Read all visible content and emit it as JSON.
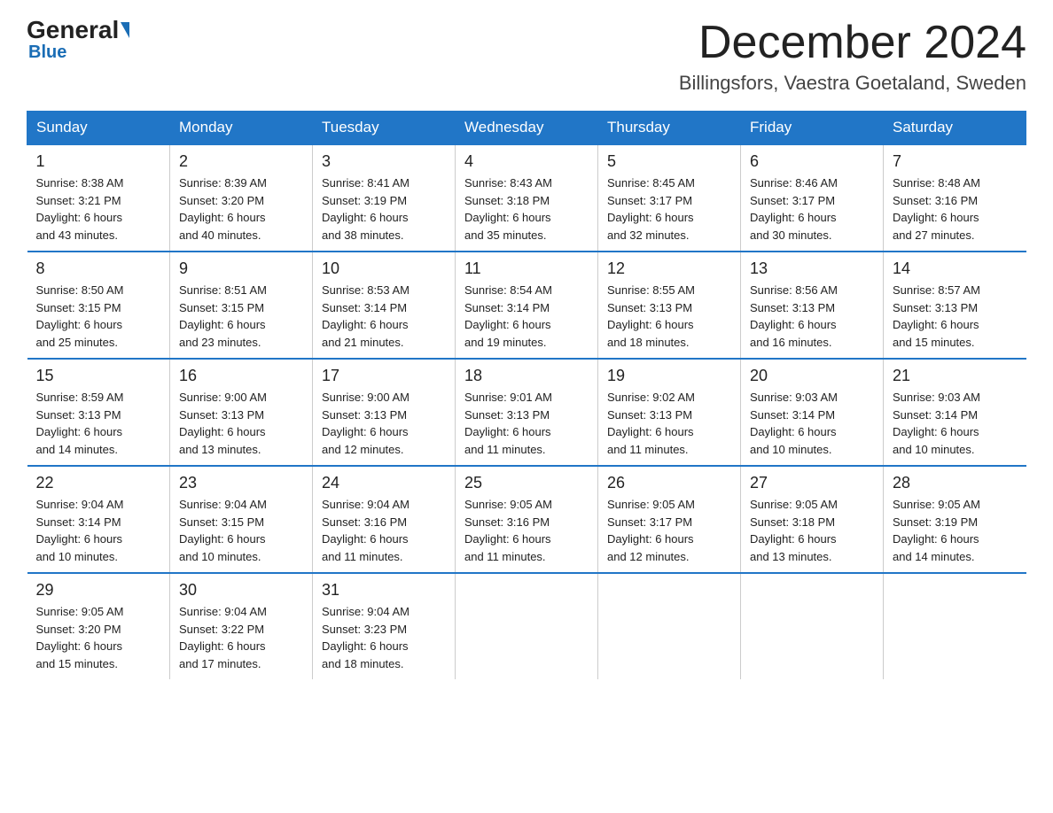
{
  "header": {
    "logo_general": "General",
    "logo_blue": "Blue",
    "month_title": "December 2024",
    "location": "Billingsfors, Vaestra Goetaland, Sweden"
  },
  "days_of_week": [
    "Sunday",
    "Monday",
    "Tuesday",
    "Wednesday",
    "Thursday",
    "Friday",
    "Saturday"
  ],
  "weeks": [
    [
      {
        "day": "1",
        "sunrise": "8:38 AM",
        "sunset": "3:21 PM",
        "daylight": "6 hours and 43 minutes."
      },
      {
        "day": "2",
        "sunrise": "8:39 AM",
        "sunset": "3:20 PM",
        "daylight": "6 hours and 40 minutes."
      },
      {
        "day": "3",
        "sunrise": "8:41 AM",
        "sunset": "3:19 PM",
        "daylight": "6 hours and 38 minutes."
      },
      {
        "day": "4",
        "sunrise": "8:43 AM",
        "sunset": "3:18 PM",
        "daylight": "6 hours and 35 minutes."
      },
      {
        "day": "5",
        "sunrise": "8:45 AM",
        "sunset": "3:17 PM",
        "daylight": "6 hours and 32 minutes."
      },
      {
        "day": "6",
        "sunrise": "8:46 AM",
        "sunset": "3:17 PM",
        "daylight": "6 hours and 30 minutes."
      },
      {
        "day": "7",
        "sunrise": "8:48 AM",
        "sunset": "3:16 PM",
        "daylight": "6 hours and 27 minutes."
      }
    ],
    [
      {
        "day": "8",
        "sunrise": "8:50 AM",
        "sunset": "3:15 PM",
        "daylight": "6 hours and 25 minutes."
      },
      {
        "day": "9",
        "sunrise": "8:51 AM",
        "sunset": "3:15 PM",
        "daylight": "6 hours and 23 minutes."
      },
      {
        "day": "10",
        "sunrise": "8:53 AM",
        "sunset": "3:14 PM",
        "daylight": "6 hours and 21 minutes."
      },
      {
        "day": "11",
        "sunrise": "8:54 AM",
        "sunset": "3:14 PM",
        "daylight": "6 hours and 19 minutes."
      },
      {
        "day": "12",
        "sunrise": "8:55 AM",
        "sunset": "3:13 PM",
        "daylight": "6 hours and 18 minutes."
      },
      {
        "day": "13",
        "sunrise": "8:56 AM",
        "sunset": "3:13 PM",
        "daylight": "6 hours and 16 minutes."
      },
      {
        "day": "14",
        "sunrise": "8:57 AM",
        "sunset": "3:13 PM",
        "daylight": "6 hours and 15 minutes."
      }
    ],
    [
      {
        "day": "15",
        "sunrise": "8:59 AM",
        "sunset": "3:13 PM",
        "daylight": "6 hours and 14 minutes."
      },
      {
        "day": "16",
        "sunrise": "9:00 AM",
        "sunset": "3:13 PM",
        "daylight": "6 hours and 13 minutes."
      },
      {
        "day": "17",
        "sunrise": "9:00 AM",
        "sunset": "3:13 PM",
        "daylight": "6 hours and 12 minutes."
      },
      {
        "day": "18",
        "sunrise": "9:01 AM",
        "sunset": "3:13 PM",
        "daylight": "6 hours and 11 minutes."
      },
      {
        "day": "19",
        "sunrise": "9:02 AM",
        "sunset": "3:13 PM",
        "daylight": "6 hours and 11 minutes."
      },
      {
        "day": "20",
        "sunrise": "9:03 AM",
        "sunset": "3:14 PM",
        "daylight": "6 hours and 10 minutes."
      },
      {
        "day": "21",
        "sunrise": "9:03 AM",
        "sunset": "3:14 PM",
        "daylight": "6 hours and 10 minutes."
      }
    ],
    [
      {
        "day": "22",
        "sunrise": "9:04 AM",
        "sunset": "3:14 PM",
        "daylight": "6 hours and 10 minutes."
      },
      {
        "day": "23",
        "sunrise": "9:04 AM",
        "sunset": "3:15 PM",
        "daylight": "6 hours and 10 minutes."
      },
      {
        "day": "24",
        "sunrise": "9:04 AM",
        "sunset": "3:16 PM",
        "daylight": "6 hours and 11 minutes."
      },
      {
        "day": "25",
        "sunrise": "9:05 AM",
        "sunset": "3:16 PM",
        "daylight": "6 hours and 11 minutes."
      },
      {
        "day": "26",
        "sunrise": "9:05 AM",
        "sunset": "3:17 PM",
        "daylight": "6 hours and 12 minutes."
      },
      {
        "day": "27",
        "sunrise": "9:05 AM",
        "sunset": "3:18 PM",
        "daylight": "6 hours and 13 minutes."
      },
      {
        "day": "28",
        "sunrise": "9:05 AM",
        "sunset": "3:19 PM",
        "daylight": "6 hours and 14 minutes."
      }
    ],
    [
      {
        "day": "29",
        "sunrise": "9:05 AM",
        "sunset": "3:20 PM",
        "daylight": "6 hours and 15 minutes."
      },
      {
        "day": "30",
        "sunrise": "9:04 AM",
        "sunset": "3:22 PM",
        "daylight": "6 hours and 17 minutes."
      },
      {
        "day": "31",
        "sunrise": "9:04 AM",
        "sunset": "3:23 PM",
        "daylight": "6 hours and 18 minutes."
      },
      null,
      null,
      null,
      null
    ]
  ]
}
